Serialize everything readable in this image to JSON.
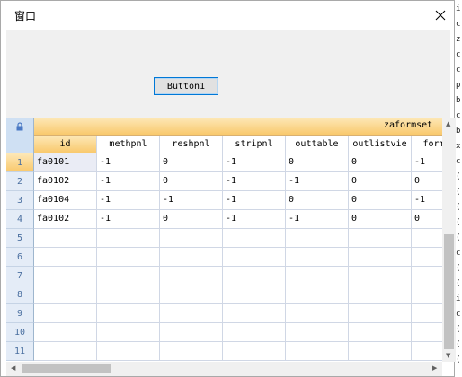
{
  "window": {
    "title": "窗口"
  },
  "toolbar": {
    "button1_label": "Button1"
  },
  "grid": {
    "band_label": "zaformset",
    "columns": [
      {
        "label": "id"
      },
      {
        "label": "methpnl"
      },
      {
        "label": "reshpnl"
      },
      {
        "label": "stripnl"
      },
      {
        "label": "outtable"
      },
      {
        "label": "outlistvie"
      },
      {
        "label": "form"
      }
    ],
    "rows": [
      {
        "num": "1",
        "cells": [
          "fa0101",
          "-1",
          "0",
          "-1",
          "0",
          "0",
          "-1"
        ]
      },
      {
        "num": "2",
        "cells": [
          "fa0102",
          "-1",
          "0",
          "-1",
          "-1",
          "0",
          "0"
        ]
      },
      {
        "num": "3",
        "cells": [
          "fa0104",
          "-1",
          "-1",
          "-1",
          "0",
          "0",
          "-1"
        ]
      },
      {
        "num": "4",
        "cells": [
          "fa0102",
          "-1",
          "0",
          "-1",
          "-1",
          "0",
          "0"
        ]
      },
      {
        "num": "5",
        "cells": [
          "",
          "",
          "",
          "",
          "",
          "",
          ""
        ]
      },
      {
        "num": "6",
        "cells": [
          "",
          "",
          "",
          "",
          "",
          "",
          ""
        ]
      },
      {
        "num": "7",
        "cells": [
          "",
          "",
          "",
          "",
          "",
          "",
          ""
        ]
      },
      {
        "num": "8",
        "cells": [
          "",
          "",
          "",
          "",
          "",
          "",
          ""
        ]
      },
      {
        "num": "9",
        "cells": [
          "",
          "",
          "",
          "",
          "",
          "",
          ""
        ]
      },
      {
        "num": "10",
        "cells": [
          "",
          "",
          "",
          "",
          "",
          "",
          ""
        ]
      },
      {
        "num": "11",
        "cells": [
          "",
          "",
          "",
          "",
          "",
          "",
          ""
        ]
      }
    ]
  },
  "background_text": [
    "i",
    "c",
    "z",
    "c",
    "c",
    "p",
    "b",
    "c",
    "b",
    "x",
    "c",
    "(",
    "(",
    "(",
    "(",
    "(",
    "c",
    "(",
    "(",
    "i",
    "c",
    "(",
    "(",
    "("
  ],
  "colors": {
    "accent": "#0078d7",
    "header_orange": "#f9c96d",
    "row_header": "#e4ecf7"
  },
  "icons": {
    "close": "close-icon",
    "corner": "lock-icon"
  }
}
